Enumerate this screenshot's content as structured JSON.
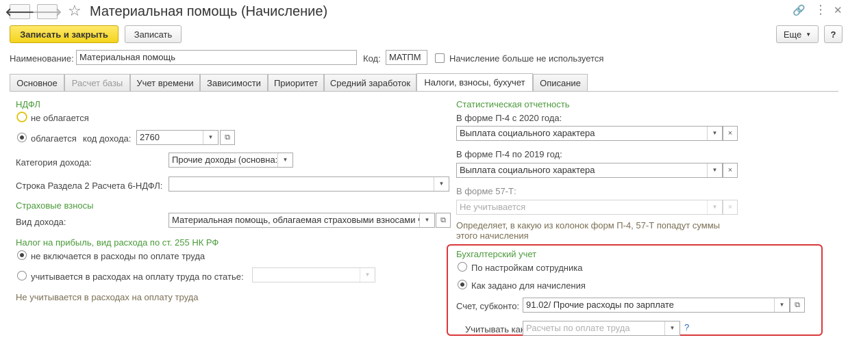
{
  "window": {
    "title": "Материальная помощь (Начисление)",
    "nav_back_icon": "arrow-left",
    "nav_forward_icon": "arrow-right"
  },
  "toolbar": {
    "save_close": "Записать и закрыть",
    "save": "Записать",
    "more": "Еще",
    "help": "?"
  },
  "header": {
    "name_label": "Наименование:",
    "name_value": "Материальная помощь",
    "code_label": "Код:",
    "code_value": "МАТПМ",
    "unused_label": "Начисление больше не используется"
  },
  "tabs": [
    {
      "label": "Основное"
    },
    {
      "label": "Расчет базы"
    },
    {
      "label": "Учет времени"
    },
    {
      "label": "Зависимости"
    },
    {
      "label": "Приоритет"
    },
    {
      "label": "Средний заработок"
    },
    {
      "label": "Налоги, взносы, бухучет"
    },
    {
      "label": "Описание"
    }
  ],
  "left": {
    "ndfl_title": "НДФЛ",
    "ndfl_not_taxed": "не облагается",
    "ndfl_taxed": "облагается",
    "income_code_label": "код дохода:",
    "income_code_value": "2760",
    "income_category_label": "Категория дохода:",
    "income_category_value": "Прочие доходы (основна:",
    "section2_label": "Строка Раздела 2 Расчета 6-НДФЛ:",
    "section2_value": "",
    "insurance_title": "Страховые взносы",
    "income_type_label": "Вид дохода:",
    "income_type_value": "Материальная помощь, облагаемая страховыми взносами ч",
    "profit_tax_title": "Налог на прибыль, вид расхода по ст. 255 НК РФ",
    "profit_not_included": "не включается в расходы по оплате труда",
    "profit_included": "учитывается в расходах на оплату труда по статье:",
    "profit_article_value": "",
    "profit_note": "Не учитывается в расходах на оплату труда"
  },
  "right": {
    "stat_title": "Статистическая отчетность",
    "p4_2020_label": "В форме П-4 с 2020 года:",
    "p4_2020_value": "Выплата социального характера",
    "p4_2019_label": "В форме П-4 по 2019 год:",
    "p4_2019_value": "Выплата социального характера",
    "f57_label": "В форме 57-Т:",
    "f57_value": "Не учитывается",
    "stat_note": "Определяет, в какую из колонок форм П-4, 57-Т попадут суммы этого начисления",
    "acc_title": "Бухгалтерский учет",
    "acc_by_employee": "По настройкам сотрудника",
    "acc_as_set": "Как задано для начисления",
    "account_label": "Счет, субконто:",
    "account_value": "91.02/ Прочие расходы по зарплате",
    "consider_label": "Учитывать как:",
    "consider_placeholder": "Расчеты по оплате труда",
    "consider_help": "?"
  },
  "colors": {
    "section_green": "#4a9a3a",
    "primary_yellow": "#f4d41c",
    "highlight_red": "#d9383a"
  }
}
